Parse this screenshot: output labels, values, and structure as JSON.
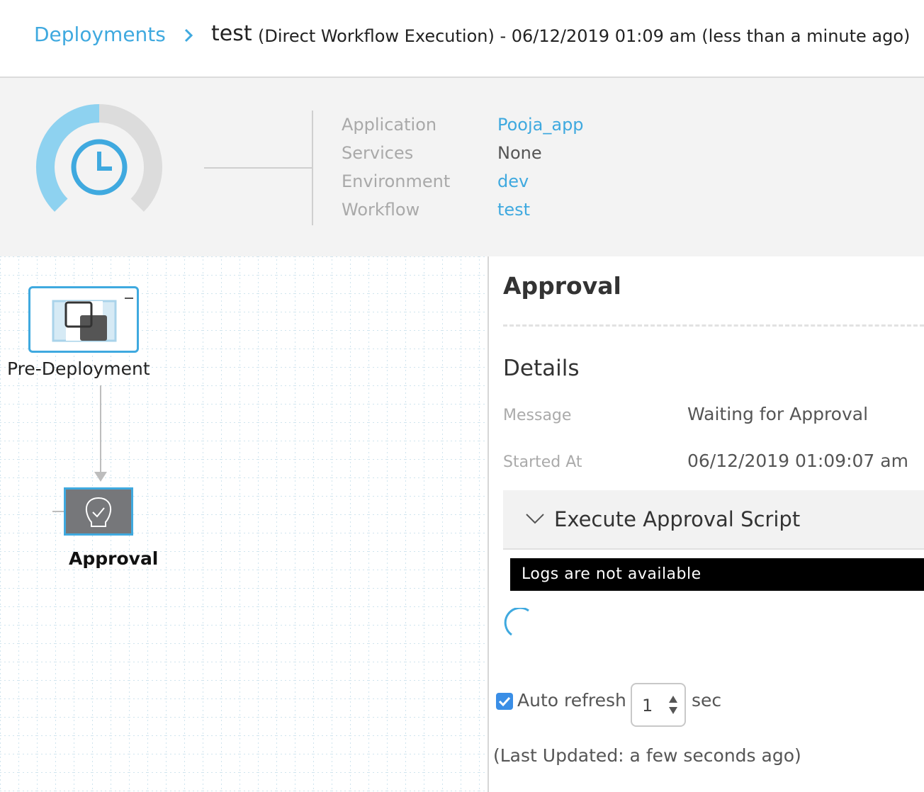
{
  "header": {
    "breadcrumb_link": "Deployments",
    "execution_name": "test",
    "execution_detail": "(Direct Workflow Execution)  - 06/12/2019 01:09 am (less than a minute ago)"
  },
  "summary": {
    "status_icon": "clock-icon",
    "progress_fraction": 0.5,
    "rows": [
      {
        "label": "Application",
        "value": "Pooja_app"
      },
      {
        "label": "Services",
        "value": "None"
      },
      {
        "label": "Environment",
        "value": "dev"
      },
      {
        "label": "Workflow",
        "value": "test"
      }
    ]
  },
  "graph": {
    "nodes": [
      {
        "label": "Pre-Deployment",
        "icon": "pre-deployment-icon"
      },
      {
        "label": "Approval",
        "icon": "approval-icon"
      }
    ]
  },
  "details_panel": {
    "title": "Approval",
    "section_heading": "Details",
    "fields": [
      {
        "label": "Message",
        "value": "Waiting for Approval"
      },
      {
        "label": "Started At",
        "value": "06/12/2019 01:09:07 am"
      }
    ],
    "script_section": {
      "title": "Execute Approval Script",
      "logs_text": "Logs are not available"
    },
    "auto_refresh": {
      "label": "Auto refresh",
      "checked": true,
      "interval_value": "1",
      "unit": "sec",
      "last_updated": "(Last Updated: a few seconds ago)"
    }
  },
  "colors": {
    "accent": "#3fa9df",
    "gauge_fill": "#8ed2f0",
    "gauge_track": "#dcdcdc",
    "node_dark": "#76777a",
    "checkbox": "#3a8ee6"
  }
}
